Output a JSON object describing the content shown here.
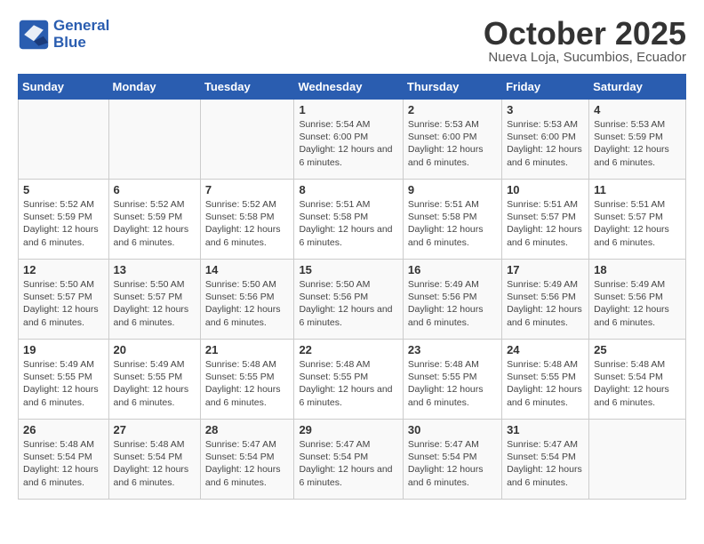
{
  "header": {
    "logo_line1": "General",
    "logo_line2": "Blue",
    "title": "October 2025",
    "subtitle": "Nueva Loja, Sucumbios, Ecuador"
  },
  "days_of_week": [
    "Sunday",
    "Monday",
    "Tuesday",
    "Wednesday",
    "Thursday",
    "Friday",
    "Saturday"
  ],
  "weeks": [
    [
      {
        "num": "",
        "info": ""
      },
      {
        "num": "",
        "info": ""
      },
      {
        "num": "",
        "info": ""
      },
      {
        "num": "1",
        "info": "Sunrise: 5:54 AM\nSunset: 6:00 PM\nDaylight: 12 hours and 6 minutes."
      },
      {
        "num": "2",
        "info": "Sunrise: 5:53 AM\nSunset: 6:00 PM\nDaylight: 12 hours and 6 minutes."
      },
      {
        "num": "3",
        "info": "Sunrise: 5:53 AM\nSunset: 6:00 PM\nDaylight: 12 hours and 6 minutes."
      },
      {
        "num": "4",
        "info": "Sunrise: 5:53 AM\nSunset: 5:59 PM\nDaylight: 12 hours and 6 minutes."
      }
    ],
    [
      {
        "num": "5",
        "info": "Sunrise: 5:52 AM\nSunset: 5:59 PM\nDaylight: 12 hours and 6 minutes."
      },
      {
        "num": "6",
        "info": "Sunrise: 5:52 AM\nSunset: 5:59 PM\nDaylight: 12 hours and 6 minutes."
      },
      {
        "num": "7",
        "info": "Sunrise: 5:52 AM\nSunset: 5:58 PM\nDaylight: 12 hours and 6 minutes."
      },
      {
        "num": "8",
        "info": "Sunrise: 5:51 AM\nSunset: 5:58 PM\nDaylight: 12 hours and 6 minutes."
      },
      {
        "num": "9",
        "info": "Sunrise: 5:51 AM\nSunset: 5:58 PM\nDaylight: 12 hours and 6 minutes."
      },
      {
        "num": "10",
        "info": "Sunrise: 5:51 AM\nSunset: 5:57 PM\nDaylight: 12 hours and 6 minutes."
      },
      {
        "num": "11",
        "info": "Sunrise: 5:51 AM\nSunset: 5:57 PM\nDaylight: 12 hours and 6 minutes."
      }
    ],
    [
      {
        "num": "12",
        "info": "Sunrise: 5:50 AM\nSunset: 5:57 PM\nDaylight: 12 hours and 6 minutes."
      },
      {
        "num": "13",
        "info": "Sunrise: 5:50 AM\nSunset: 5:57 PM\nDaylight: 12 hours and 6 minutes."
      },
      {
        "num": "14",
        "info": "Sunrise: 5:50 AM\nSunset: 5:56 PM\nDaylight: 12 hours and 6 minutes."
      },
      {
        "num": "15",
        "info": "Sunrise: 5:50 AM\nSunset: 5:56 PM\nDaylight: 12 hours and 6 minutes."
      },
      {
        "num": "16",
        "info": "Sunrise: 5:49 AM\nSunset: 5:56 PM\nDaylight: 12 hours and 6 minutes."
      },
      {
        "num": "17",
        "info": "Sunrise: 5:49 AM\nSunset: 5:56 PM\nDaylight: 12 hours and 6 minutes."
      },
      {
        "num": "18",
        "info": "Sunrise: 5:49 AM\nSunset: 5:56 PM\nDaylight: 12 hours and 6 minutes."
      }
    ],
    [
      {
        "num": "19",
        "info": "Sunrise: 5:49 AM\nSunset: 5:55 PM\nDaylight: 12 hours and 6 minutes."
      },
      {
        "num": "20",
        "info": "Sunrise: 5:49 AM\nSunset: 5:55 PM\nDaylight: 12 hours and 6 minutes."
      },
      {
        "num": "21",
        "info": "Sunrise: 5:48 AM\nSunset: 5:55 PM\nDaylight: 12 hours and 6 minutes."
      },
      {
        "num": "22",
        "info": "Sunrise: 5:48 AM\nSunset: 5:55 PM\nDaylight: 12 hours and 6 minutes."
      },
      {
        "num": "23",
        "info": "Sunrise: 5:48 AM\nSunset: 5:55 PM\nDaylight: 12 hours and 6 minutes."
      },
      {
        "num": "24",
        "info": "Sunrise: 5:48 AM\nSunset: 5:55 PM\nDaylight: 12 hours and 6 minutes."
      },
      {
        "num": "25",
        "info": "Sunrise: 5:48 AM\nSunset: 5:54 PM\nDaylight: 12 hours and 6 minutes."
      }
    ],
    [
      {
        "num": "26",
        "info": "Sunrise: 5:48 AM\nSunset: 5:54 PM\nDaylight: 12 hours and 6 minutes."
      },
      {
        "num": "27",
        "info": "Sunrise: 5:48 AM\nSunset: 5:54 PM\nDaylight: 12 hours and 6 minutes."
      },
      {
        "num": "28",
        "info": "Sunrise: 5:47 AM\nSunset: 5:54 PM\nDaylight: 12 hours and 6 minutes."
      },
      {
        "num": "29",
        "info": "Sunrise: 5:47 AM\nSunset: 5:54 PM\nDaylight: 12 hours and 6 minutes."
      },
      {
        "num": "30",
        "info": "Sunrise: 5:47 AM\nSunset: 5:54 PM\nDaylight: 12 hours and 6 minutes."
      },
      {
        "num": "31",
        "info": "Sunrise: 5:47 AM\nSunset: 5:54 PM\nDaylight: 12 hours and 6 minutes."
      },
      {
        "num": "",
        "info": ""
      }
    ]
  ]
}
